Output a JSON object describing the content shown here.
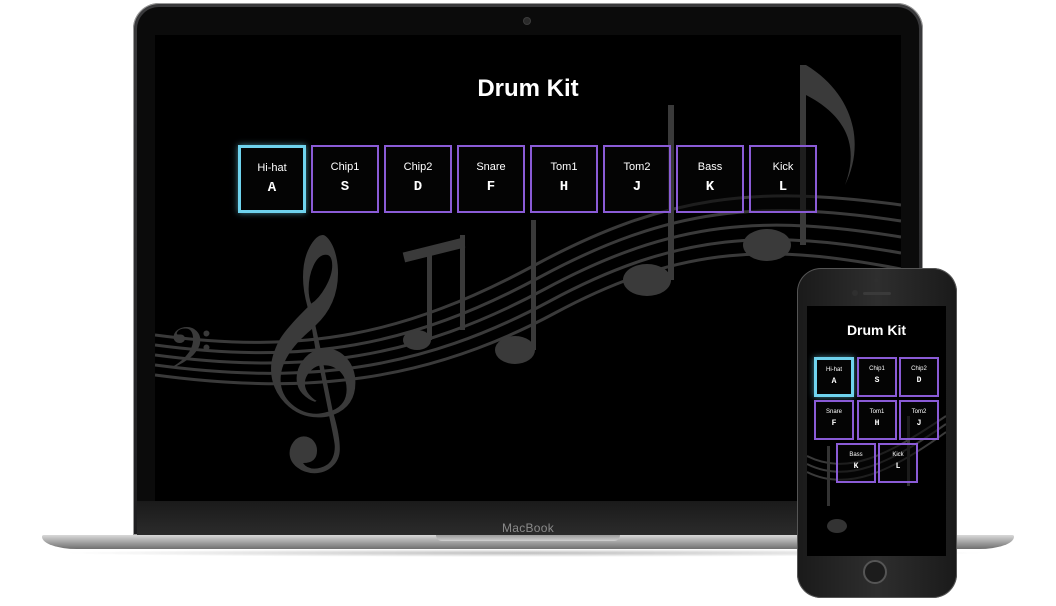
{
  "app": {
    "title": "Drum Kit",
    "accent_color": "#8a5bd6",
    "active_color": "#6fd3ee"
  },
  "device": {
    "brand": "MacBook"
  },
  "keys": [
    {
      "name": "Hi-hat",
      "letter": "A",
      "active": true
    },
    {
      "name": "Chip1",
      "letter": "S",
      "active": false
    },
    {
      "name": "Chip2",
      "letter": "D",
      "active": false
    },
    {
      "name": "Snare",
      "letter": "F",
      "active": false
    },
    {
      "name": "Tom1",
      "letter": "H",
      "active": false
    },
    {
      "name": "Tom2",
      "letter": "J",
      "active": false
    },
    {
      "name": "Bass",
      "letter": "K",
      "active": false
    },
    {
      "name": "Kick",
      "letter": "L",
      "active": false
    }
  ]
}
